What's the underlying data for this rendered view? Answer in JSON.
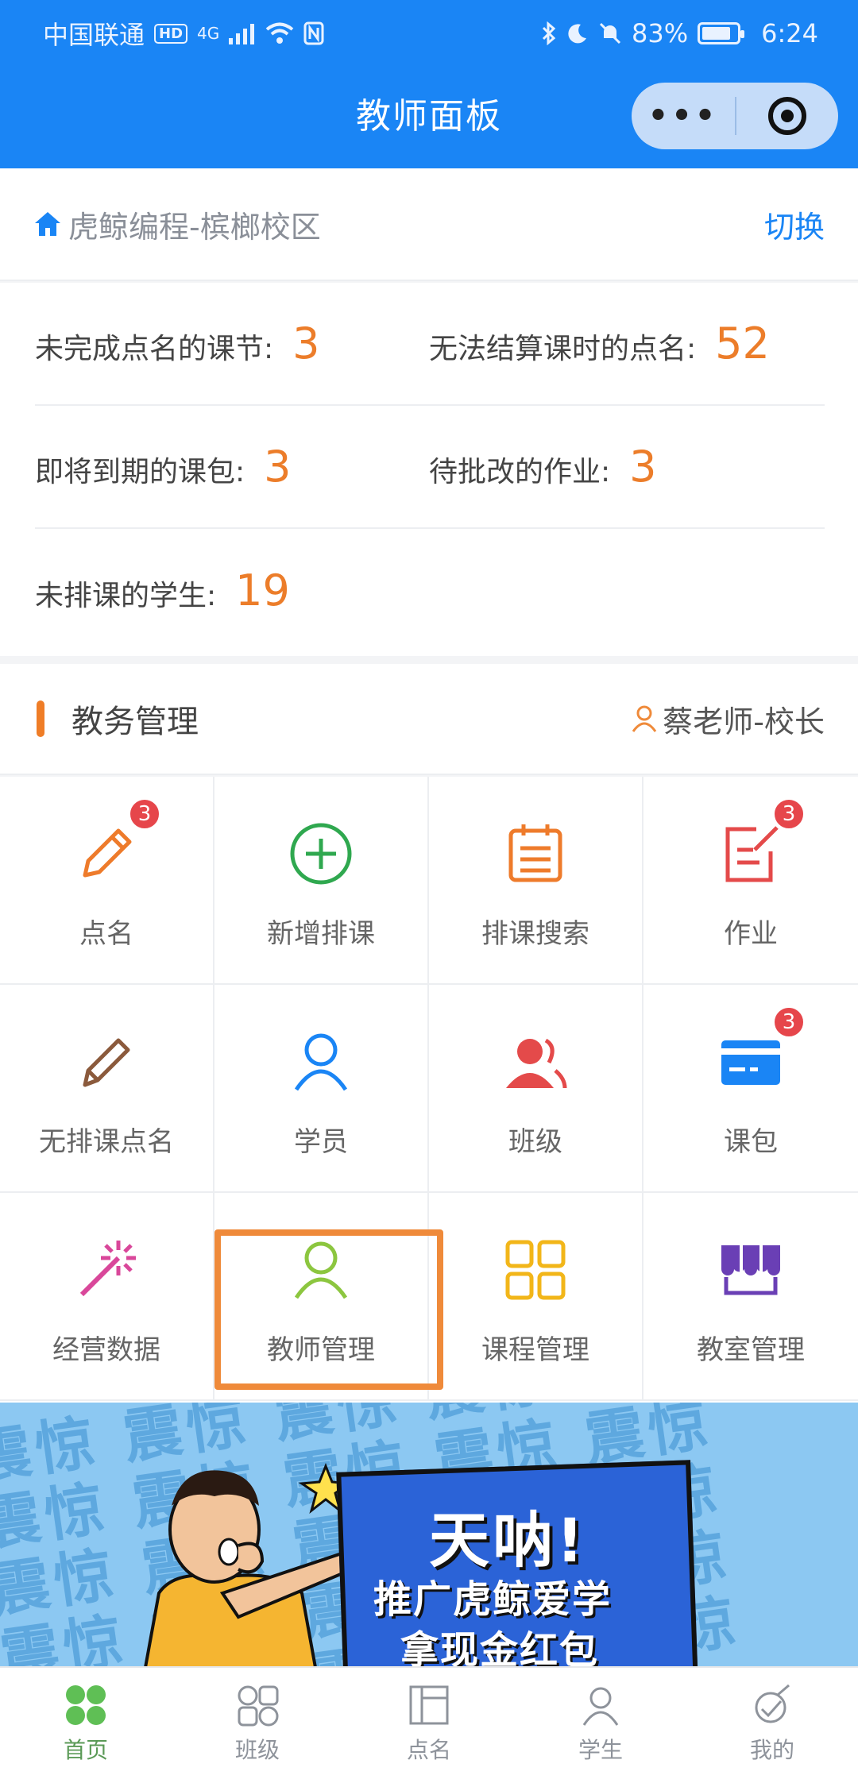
{
  "status_bar": {
    "carrier": "中国联通",
    "hd": "HD",
    "network": "4G",
    "battery_text": "83%",
    "battery_level": 0.83,
    "time": "6:24"
  },
  "nav": {
    "title": "教师面板",
    "more_label": "•••"
  },
  "campus": {
    "name": "虎鲸编程-槟榔校区",
    "switch_label": "切换"
  },
  "stats": [
    {
      "label": "未完成点名的课节:",
      "value": "3"
    },
    {
      "label": "无法结算课时的点名:",
      "value": "52"
    },
    {
      "label": "即将到期的课包:",
      "value": "3"
    },
    {
      "label": "待批改的作业:",
      "value": "3"
    },
    {
      "label": "未排课的学生:",
      "value": "19"
    }
  ],
  "section": {
    "title": "教务管理",
    "user": "蔡老师-校长"
  },
  "grid": [
    {
      "label": "点名",
      "icon": "pencil-icon",
      "badge": "3",
      "color": "#ee7b2b"
    },
    {
      "label": "新增排课",
      "icon": "plus-circle-icon",
      "badge": "",
      "color": "#2fa84f"
    },
    {
      "label": "排课搜索",
      "icon": "calendar-list-icon",
      "badge": "",
      "color": "#ee7b2b"
    },
    {
      "label": "作业",
      "icon": "edit-note-icon",
      "badge": "3",
      "color": "#e44a4a"
    },
    {
      "label": "无排课点名",
      "icon": "pencil-outline-icon",
      "badge": "",
      "color": "#8b5a3c"
    },
    {
      "label": "学员",
      "icon": "person-icon",
      "badge": "",
      "color": "#1a85f5"
    },
    {
      "label": "班级",
      "icon": "group-icon",
      "badge": "",
      "color": "#e44a4a"
    },
    {
      "label": "课包",
      "icon": "card-icon",
      "badge": "3",
      "color": "#1a85f5"
    },
    {
      "label": "经营数据",
      "icon": "sparkle-wand-icon",
      "badge": "",
      "color": "#d9479a"
    },
    {
      "label": "教师管理",
      "icon": "person-icon",
      "badge": "",
      "color": "#8cc63f"
    },
    {
      "label": "课程管理",
      "icon": "grid-squares-icon",
      "badge": "",
      "color": "#f2b619"
    },
    {
      "label": "教室管理",
      "icon": "classroom-icon",
      "badge": "",
      "color": "#6a3fb5"
    }
  ],
  "banner": {
    "headline": "天呐!",
    "line1": "推广虎鲸爱学",
    "line2": "拿现金红包",
    "pattern_text": "震惊 震惊 震惊 震惊 震惊"
  },
  "tabbar": [
    {
      "label": "首页",
      "icon": "home-icon",
      "active": true
    },
    {
      "label": "班级",
      "icon": "class-icon",
      "active": false
    },
    {
      "label": "点名",
      "icon": "rollcall-icon",
      "active": false
    },
    {
      "label": "学生",
      "icon": "student-icon",
      "active": false
    },
    {
      "label": "我的",
      "icon": "profile-icon",
      "active": false
    }
  ],
  "colors": {
    "primary": "#1a85f5",
    "accent": "#ef7d27",
    "badge": "#e6464b"
  }
}
